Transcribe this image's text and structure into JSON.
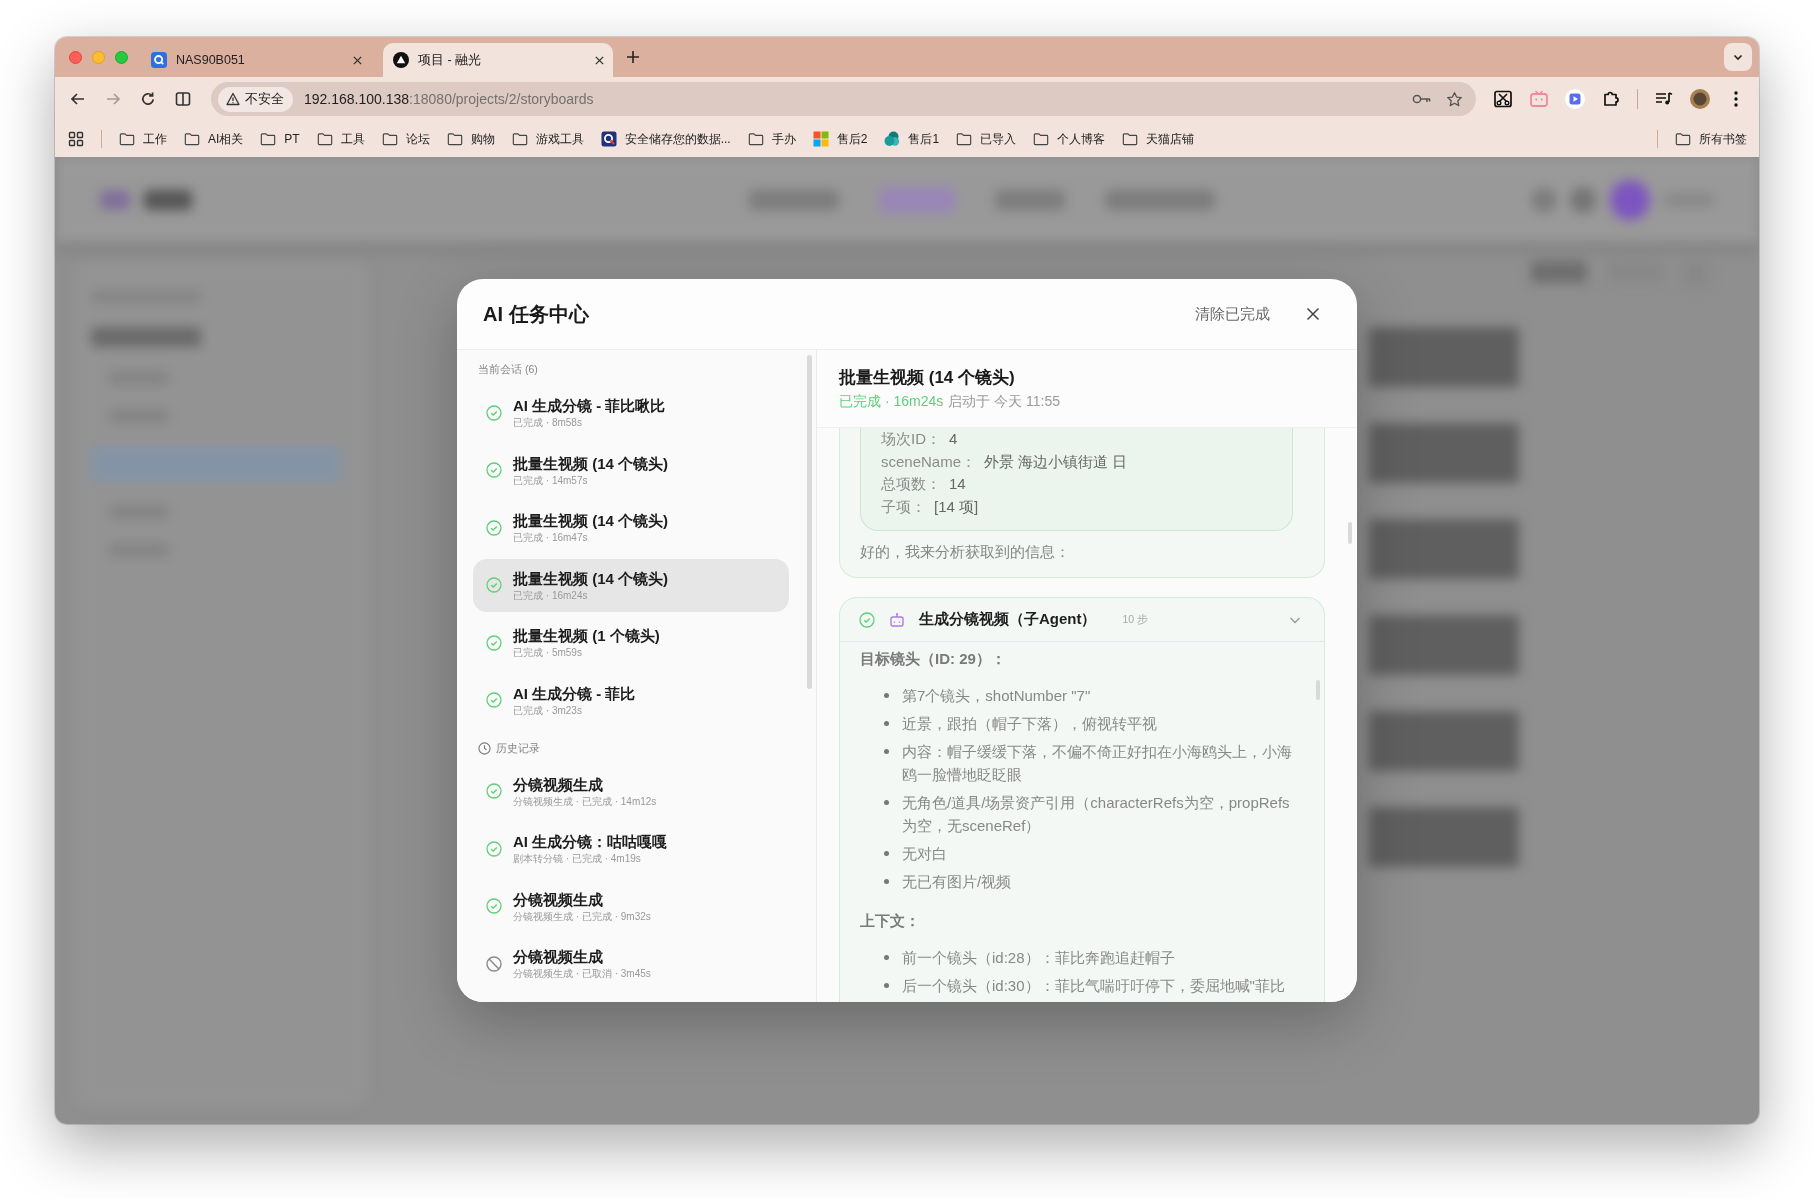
{
  "browser": {
    "tabs": [
      {
        "title": "NAS90B051",
        "kind": "tile",
        "selected": false
      },
      {
        "title": "项目 - 融光",
        "kind": "disc",
        "selected": true
      }
    ],
    "security_label": "不安全",
    "url": {
      "host": "192.168.100.138",
      "path": ":18080/projects/2/storyboards"
    },
    "bookmarks": [
      {
        "label": "工作",
        "kind": "folder"
      },
      {
        "label": "AI相关",
        "kind": "folder"
      },
      {
        "label": "PT",
        "kind": "folder"
      },
      {
        "label": "工具",
        "kind": "folder"
      },
      {
        "label": "论坛",
        "kind": "folder"
      },
      {
        "label": "购物",
        "kind": "folder"
      },
      {
        "label": "游戏工具",
        "kind": "folder"
      },
      {
        "label": "安全储存您的数据...",
        "kind": "tile"
      },
      {
        "label": "手办",
        "kind": "folder"
      },
      {
        "label": "售后2",
        "kind": "quad"
      },
      {
        "label": "售后1",
        "kind": "bubble"
      },
      {
        "label": "已导入",
        "kind": "folder"
      },
      {
        "label": "个人博客",
        "kind": "folder"
      },
      {
        "label": "天猫店铺",
        "kind": "folder"
      }
    ],
    "all_bookmarks": "所有书签"
  },
  "modal": {
    "title": "AI 任务中心",
    "clear_button": "清除已完成",
    "sections": [
      {
        "heading": "当前会话 (6)",
        "kind": "current",
        "items": [
          {
            "title": "AI 生成分镜 - 菲比啾比",
            "meta": "已完成 · 8m58s",
            "cancelled": false,
            "selected": false
          },
          {
            "title": "批量生视频 (14 个镜头)",
            "meta": "已完成 · 14m57s",
            "cancelled": false,
            "selected": false
          },
          {
            "title": "批量生视频 (14 个镜头)",
            "meta": "已完成 · 16m47s",
            "cancelled": false,
            "selected": false
          },
          {
            "title": "批量生视频 (14 个镜头)",
            "meta": "已完成 · 16m24s",
            "cancelled": false,
            "selected": true
          },
          {
            "title": "批量生视频 (1 个镜头)",
            "meta": "已完成 · 5m59s",
            "cancelled": false,
            "selected": false
          },
          {
            "title": "AI 生成分镜 - 菲比",
            "meta": "已完成 · 3m23s",
            "cancelled": false,
            "selected": false
          }
        ]
      },
      {
        "heading": "历史记录",
        "kind": "history",
        "items": [
          {
            "title": "分镜视频生成",
            "meta": "分镜视频生成 · 已完成 · 14m12s",
            "cancelled": false,
            "selected": false
          },
          {
            "title": "AI 生成分镜：咕咕嘎嘎",
            "meta": "剧本转分镜 · 已完成 · 4m19s",
            "cancelled": false,
            "selected": false
          },
          {
            "title": "分镜视频生成",
            "meta": "分镜视频生成 · 已完成 · 9m32s",
            "cancelled": false,
            "selected": false
          },
          {
            "title": "分镜视频生成",
            "meta": "分镜视频生成 · 已取消 · 3m45s",
            "cancelled": true,
            "selected": false
          }
        ]
      }
    ],
    "detail": {
      "title": "批量生视频 (14 个镜头)",
      "completed": true,
      "status_text": "已完成 · 16m24s",
      "started": "启动于 今天 11:55",
      "messages": [
        {
          "kind": "assistant",
          "fields": [
            {
              "label": "场次ID：",
              "value": "4"
            },
            {
              "label": "sceneName：",
              "value": "外景 海边小镇街道 日"
            },
            {
              "label": "总项数：",
              "value": "14"
            },
            {
              "label": "子项：",
              "value": "[14 项]"
            }
          ],
          "text": "好的，我来分析获取到的信息："
        },
        {
          "kind": "subagent",
          "title": "生成分镜视频（子Agent）",
          "steps": "10 步",
          "completed": true,
          "expanded": true,
          "body": [
            {
              "kind": "heading",
              "text": "目标镜头（ID: 29）："
            },
            {
              "kind": "list",
              "items": [
                "第7个镜头，shotNumber \"7\"",
                "近景，跟拍（帽子下落），俯视转平视",
                "内容：帽子缓缓下落，不偏不倚正好扣在小海鸥头上，小海鸥一脸懵地眨眨眼",
                "无角色/道具/场景资产引用（characterRefs为空，propRefs为空，无sceneRef）",
                "无对白",
                "无已有图片/视频"
              ]
            },
            {
              "kind": "heading",
              "text": "上下文："
            },
            {
              "kind": "list",
              "items": [
                "前一个镜头（id:28）：菲比奔跑追赶帽子",
                "后一个镜头（id:30）：菲比气喘吁吁停下，委屈地喊\"菲比"
              ]
            }
          ]
        }
      ]
    }
  }
}
